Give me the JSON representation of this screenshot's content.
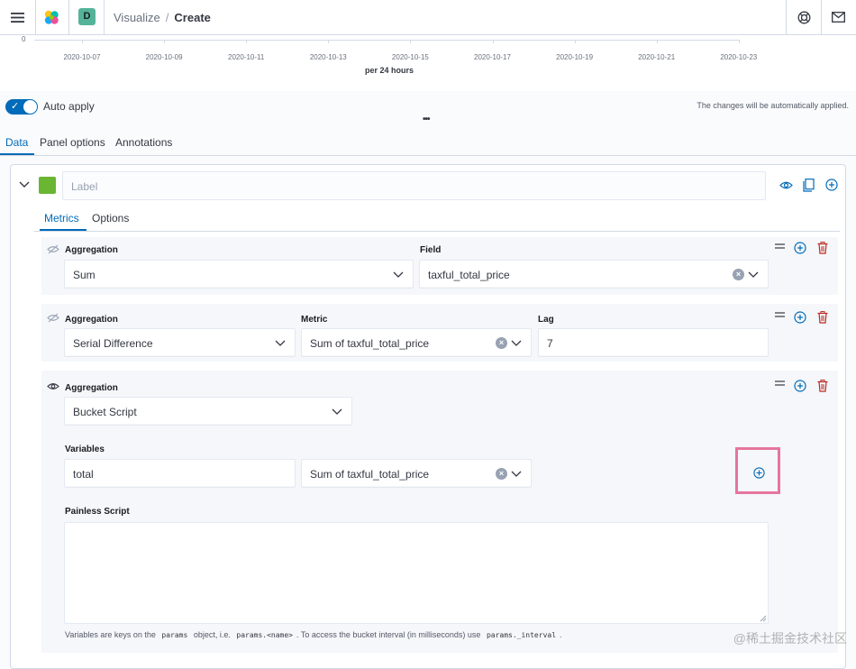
{
  "header": {
    "menu_icon": "hamburger-menu-icon",
    "logo_icon": "elastic-logo-icon",
    "space_avatar": "D",
    "breadcrumb": {
      "parent": "Visualize",
      "separator": "/",
      "current": "Create"
    },
    "help_icon": "help-lifebuoy-icon",
    "mail_icon": "newsfeed-mail-icon"
  },
  "chart": {
    "y_zero_label": "0",
    "x_ticks": [
      "2020-10-07",
      "2020-10-09",
      "2020-10-11",
      "2020-10-13",
      "2020-10-15",
      "2020-10-17",
      "2020-10-19",
      "2020-10-21",
      "2020-10-23"
    ],
    "x_title": "per 24 hours"
  },
  "auto_apply": {
    "label": "Auto apply",
    "enabled": true,
    "status_text": "The changes will be automatically applied.",
    "resize_handle": "•••"
  },
  "tabs": [
    {
      "label": "Data",
      "active": true
    },
    {
      "label": "Panel options",
      "active": false
    },
    {
      "label": "Annotations",
      "active": false
    }
  ],
  "series": {
    "label_placeholder": "Label",
    "color": "#6ab531",
    "subtabs": [
      {
        "label": "Metrics",
        "active": true
      },
      {
        "label": "Options",
        "active": false
      }
    ]
  },
  "metrics": [
    {
      "aggregation_label": "Aggregation",
      "aggregation_value": "Sum",
      "field_label": "Field",
      "field_value": "taxful_total_price"
    },
    {
      "aggregation_label": "Aggregation",
      "aggregation_value": "Serial Difference",
      "metric_label": "Metric",
      "metric_value": "Sum of taxful_total_price",
      "lag_label": "Lag",
      "lag_value": "7"
    },
    {
      "aggregation_label": "Aggregation",
      "aggregation_value": "Bucket Script",
      "variables_label": "Variables",
      "variable_name": "total",
      "variable_metric": "Sum of taxful_total_price",
      "script_label": "Painless Script",
      "help_prefix": "Variables are keys on the",
      "help_code1": "params",
      "help_mid": "object, i.e.",
      "help_code2": "params.<name>",
      "help_suffix": ". To access the bucket interval (in milliseconds) use",
      "help_code3": "params._interval",
      "help_end": "."
    }
  ],
  "watermark": "@稀土掘金技术社区"
}
